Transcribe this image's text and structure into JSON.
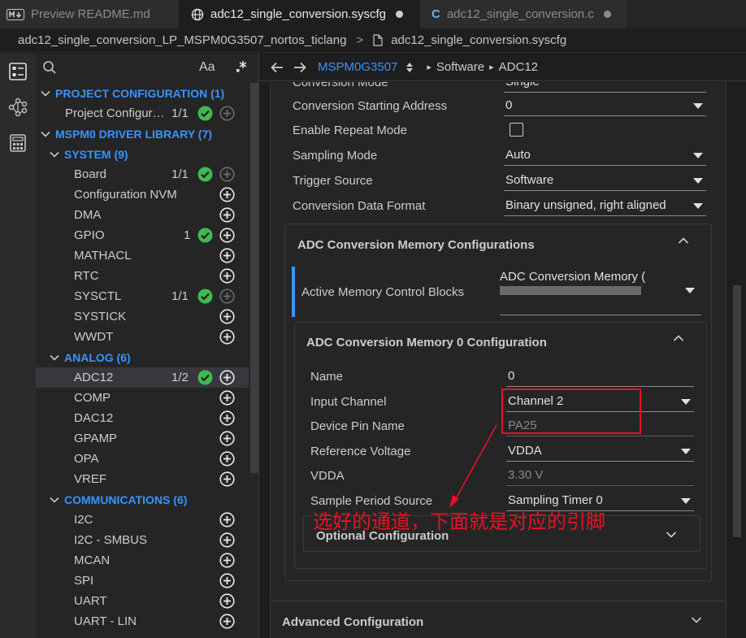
{
  "tabs": [
    {
      "label": "Preview README.md",
      "icon": "markdown-icon"
    },
    {
      "label": "adc12_single_conversion.syscfg",
      "icon": "globe-icon"
    },
    {
      "label": "adc12_single_conversion.c",
      "icon": "c-file-icon"
    }
  ],
  "breadcrumb": {
    "project": "adc12_single_conversion_LP_MSPM0G3507_nortos_ticlang",
    "separator": ">",
    "file": "adc12_single_conversion.syscfg"
  },
  "sidebar": {
    "search_toggle": "Aa",
    "tree": [
      {
        "kind": "hdr",
        "label": "PROJECT CONFIGURATION (1)",
        "indent": 0
      },
      {
        "kind": "item",
        "label": "Project Configur…",
        "indent": 1,
        "count": "1/1",
        "ok": true,
        "plus_dim": true
      },
      {
        "kind": "hdr",
        "label": "MSPM0 DRIVER LIBRARY (7)",
        "indent": 0
      },
      {
        "kind": "hdr",
        "label": "SYSTEM (9)",
        "indent": 1
      },
      {
        "kind": "item",
        "label": "Board",
        "indent": 2,
        "count": "1/1",
        "ok": true,
        "plus_dim": true
      },
      {
        "kind": "item",
        "label": "Configuration NVM",
        "indent": 2
      },
      {
        "kind": "item",
        "label": "DMA",
        "indent": 2
      },
      {
        "kind": "item",
        "label": "GPIO",
        "indent": 2,
        "count": "1",
        "ok": true
      },
      {
        "kind": "item",
        "label": "MATHACL",
        "indent": 2
      },
      {
        "kind": "item",
        "label": "RTC",
        "indent": 2
      },
      {
        "kind": "item",
        "label": "SYSCTL",
        "indent": 2,
        "count": "1/1",
        "ok": true,
        "plus_dim": true
      },
      {
        "kind": "item",
        "label": "SYSTICK",
        "indent": 2
      },
      {
        "kind": "item",
        "label": "WWDT",
        "indent": 2
      },
      {
        "kind": "hdr",
        "label": "ANALOG (6)",
        "indent": 1
      },
      {
        "kind": "item",
        "label": "ADC12",
        "indent": 2,
        "count": "1/2",
        "ok": true,
        "selected": true
      },
      {
        "kind": "item",
        "label": "COMP",
        "indent": 2
      },
      {
        "kind": "item",
        "label": "DAC12",
        "indent": 2
      },
      {
        "kind": "item",
        "label": "GPAMP",
        "indent": 2
      },
      {
        "kind": "item",
        "label": "OPA",
        "indent": 2
      },
      {
        "kind": "item",
        "label": "VREF",
        "indent": 2
      },
      {
        "kind": "hdr",
        "label": "COMMUNICATIONS (6)",
        "indent": 1
      },
      {
        "kind": "item",
        "label": "I2C",
        "indent": 2
      },
      {
        "kind": "item",
        "label": "I2C - SMBUS",
        "indent": 2
      },
      {
        "kind": "item",
        "label": "MCAN",
        "indent": 2
      },
      {
        "kind": "item",
        "label": "SPI",
        "indent": 2
      },
      {
        "kind": "item",
        "label": "UART",
        "indent": 2
      },
      {
        "kind": "item",
        "label": "UART - LIN",
        "indent": 2
      }
    ]
  },
  "nav": {
    "device": "MSPM0G3507",
    "crumb1": "Software",
    "crumb2": "ADC12"
  },
  "form": {
    "cut_label": "Conversion Mode",
    "cut_value": "Single",
    "rows": [
      {
        "label": "Conversion Starting Address",
        "value": "0",
        "type": "select"
      },
      {
        "label": "Enable Repeat Mode",
        "value": "",
        "type": "checkbox"
      },
      {
        "label": "Sampling Mode",
        "value": "Auto",
        "type": "select"
      },
      {
        "label": "Trigger Source",
        "value": "Software",
        "type": "select"
      },
      {
        "label": "Conversion Data Format",
        "value": "Binary unsigned, right aligned",
        "type": "select"
      }
    ],
    "mem_section": {
      "title": "ADC Conversion Memory Configurations",
      "active_label": "Active Memory Control Blocks",
      "active_value": "ADC Conversion Memory ("
    },
    "mem0": {
      "title": "ADC Conversion Memory 0 Configuration",
      "rows": [
        {
          "label": "Name",
          "value": "0",
          "type": "text"
        },
        {
          "label": "Input Channel",
          "value": "Channel 2",
          "type": "select"
        },
        {
          "label": "Device Pin Name",
          "value": "PA25",
          "type": "readonly"
        },
        {
          "label": "Reference Voltage",
          "value": "VDDA",
          "type": "select"
        },
        {
          "label": "VDDA",
          "value": "3.30 V",
          "type": "readonly"
        },
        {
          "label": "Sample Period Source",
          "value": "Sampling Timer 0",
          "type": "select"
        }
      ],
      "optional": "Optional Configuration"
    },
    "advanced": "Advanced Configuration"
  },
  "annotation": {
    "text": "选好的通道，下面就是对应的引脚",
    "color": "#e81123"
  },
  "colors": {
    "accent": "#3794ff",
    "ok_green": "#3fb950",
    "annotation_red": "#e81123"
  }
}
